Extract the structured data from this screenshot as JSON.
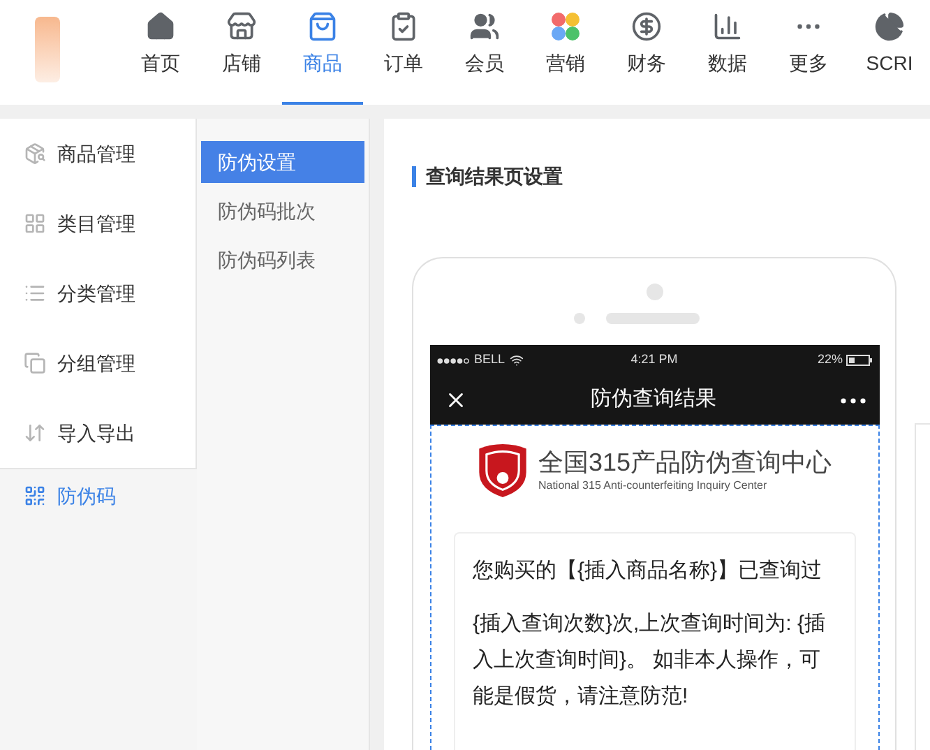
{
  "top_nav": [
    {
      "label": "首页",
      "selected": false
    },
    {
      "label": "店铺",
      "selected": false
    },
    {
      "label": "商品",
      "selected": true
    },
    {
      "label": "订单",
      "selected": false
    },
    {
      "label": "会员",
      "selected": false
    },
    {
      "label": "营销",
      "selected": false
    },
    {
      "label": "财务",
      "selected": false
    },
    {
      "label": "数据",
      "selected": false
    },
    {
      "label": "更多",
      "selected": false
    },
    {
      "label": "SCRI",
      "selected": false
    }
  ],
  "sidebar": {
    "items": [
      {
        "label": "商品管理",
        "selected": false
      },
      {
        "label": "类目管理",
        "selected": false
      },
      {
        "label": "分类管理",
        "selected": false
      },
      {
        "label": "分组管理",
        "selected": false
      },
      {
        "label": "导入导出",
        "selected": false
      },
      {
        "label": "防伪码",
        "selected": true
      }
    ]
  },
  "submenu": [
    {
      "label": "防伪设置",
      "selected": true
    },
    {
      "label": "防伪码批次",
      "selected": false
    },
    {
      "label": "防伪码列表",
      "selected": false
    }
  ],
  "panel": {
    "title": "查询结果页设置"
  },
  "phone": {
    "status": {
      "carrier": "BELL",
      "time": "4:21 PM",
      "battery": "22%"
    },
    "nav_title": "防伪查询结果",
    "brand": {
      "name": "全国315产品防伪查询中心",
      "subtitle": "National 315 Anti-counterfeiting Inquiry Center"
    },
    "message": [
      "您购买的【{插入商品名称}】已查询过",
      "{插入查询次数}次,上次查询时间为: {插入上次查询时间}。 如非本人操作，可能是假货，请注意防范!"
    ]
  }
}
